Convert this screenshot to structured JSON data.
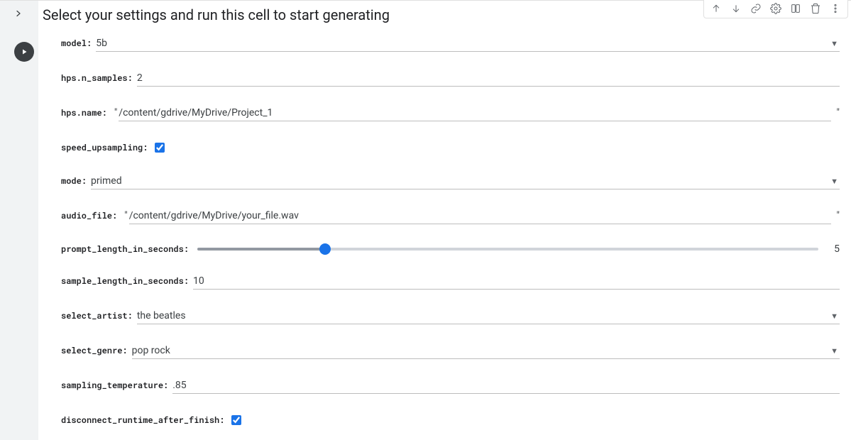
{
  "cell_title": "Select your settings and run this cell to start generating",
  "fields": {
    "model": {
      "label": "model",
      "value": "5b",
      "type": "select"
    },
    "n_samples": {
      "label": "hps.n_samples",
      "value": "2",
      "type": "text"
    },
    "name": {
      "label": "hps.name",
      "value": "/content/gdrive/MyDrive/Project_1",
      "type": "quoted-text"
    },
    "speed_upsampling": {
      "label": "speed_upsampling",
      "checked": true,
      "type": "checkbox"
    },
    "mode": {
      "label": "mode",
      "value": "primed",
      "type": "select"
    },
    "audio_file": {
      "label": "audio_file",
      "value": "/content/gdrive/MyDrive/your_file.wav",
      "type": "quoted-text"
    },
    "prompt_length": {
      "label": "prompt_length_in_seconds",
      "value": 5,
      "min": 0,
      "max": 25,
      "type": "slider"
    },
    "sample_length": {
      "label": "sample_length_in_seconds",
      "value": "10",
      "type": "text"
    },
    "select_artist": {
      "label": "select_artist",
      "value": "the beatles",
      "type": "select"
    },
    "select_genre": {
      "label": "select_genre",
      "value": "pop rock",
      "type": "select"
    },
    "sampling_temperature": {
      "label": "sampling_temperature",
      "value": ".85",
      "type": "text"
    },
    "disconnect": {
      "label": "disconnect_runtime_after_finish",
      "checked": true,
      "type": "checkbox"
    }
  },
  "toolbar": {
    "icons": [
      "arrow-up",
      "arrow-down",
      "link",
      "gear",
      "mirror",
      "trash",
      "more"
    ]
  }
}
